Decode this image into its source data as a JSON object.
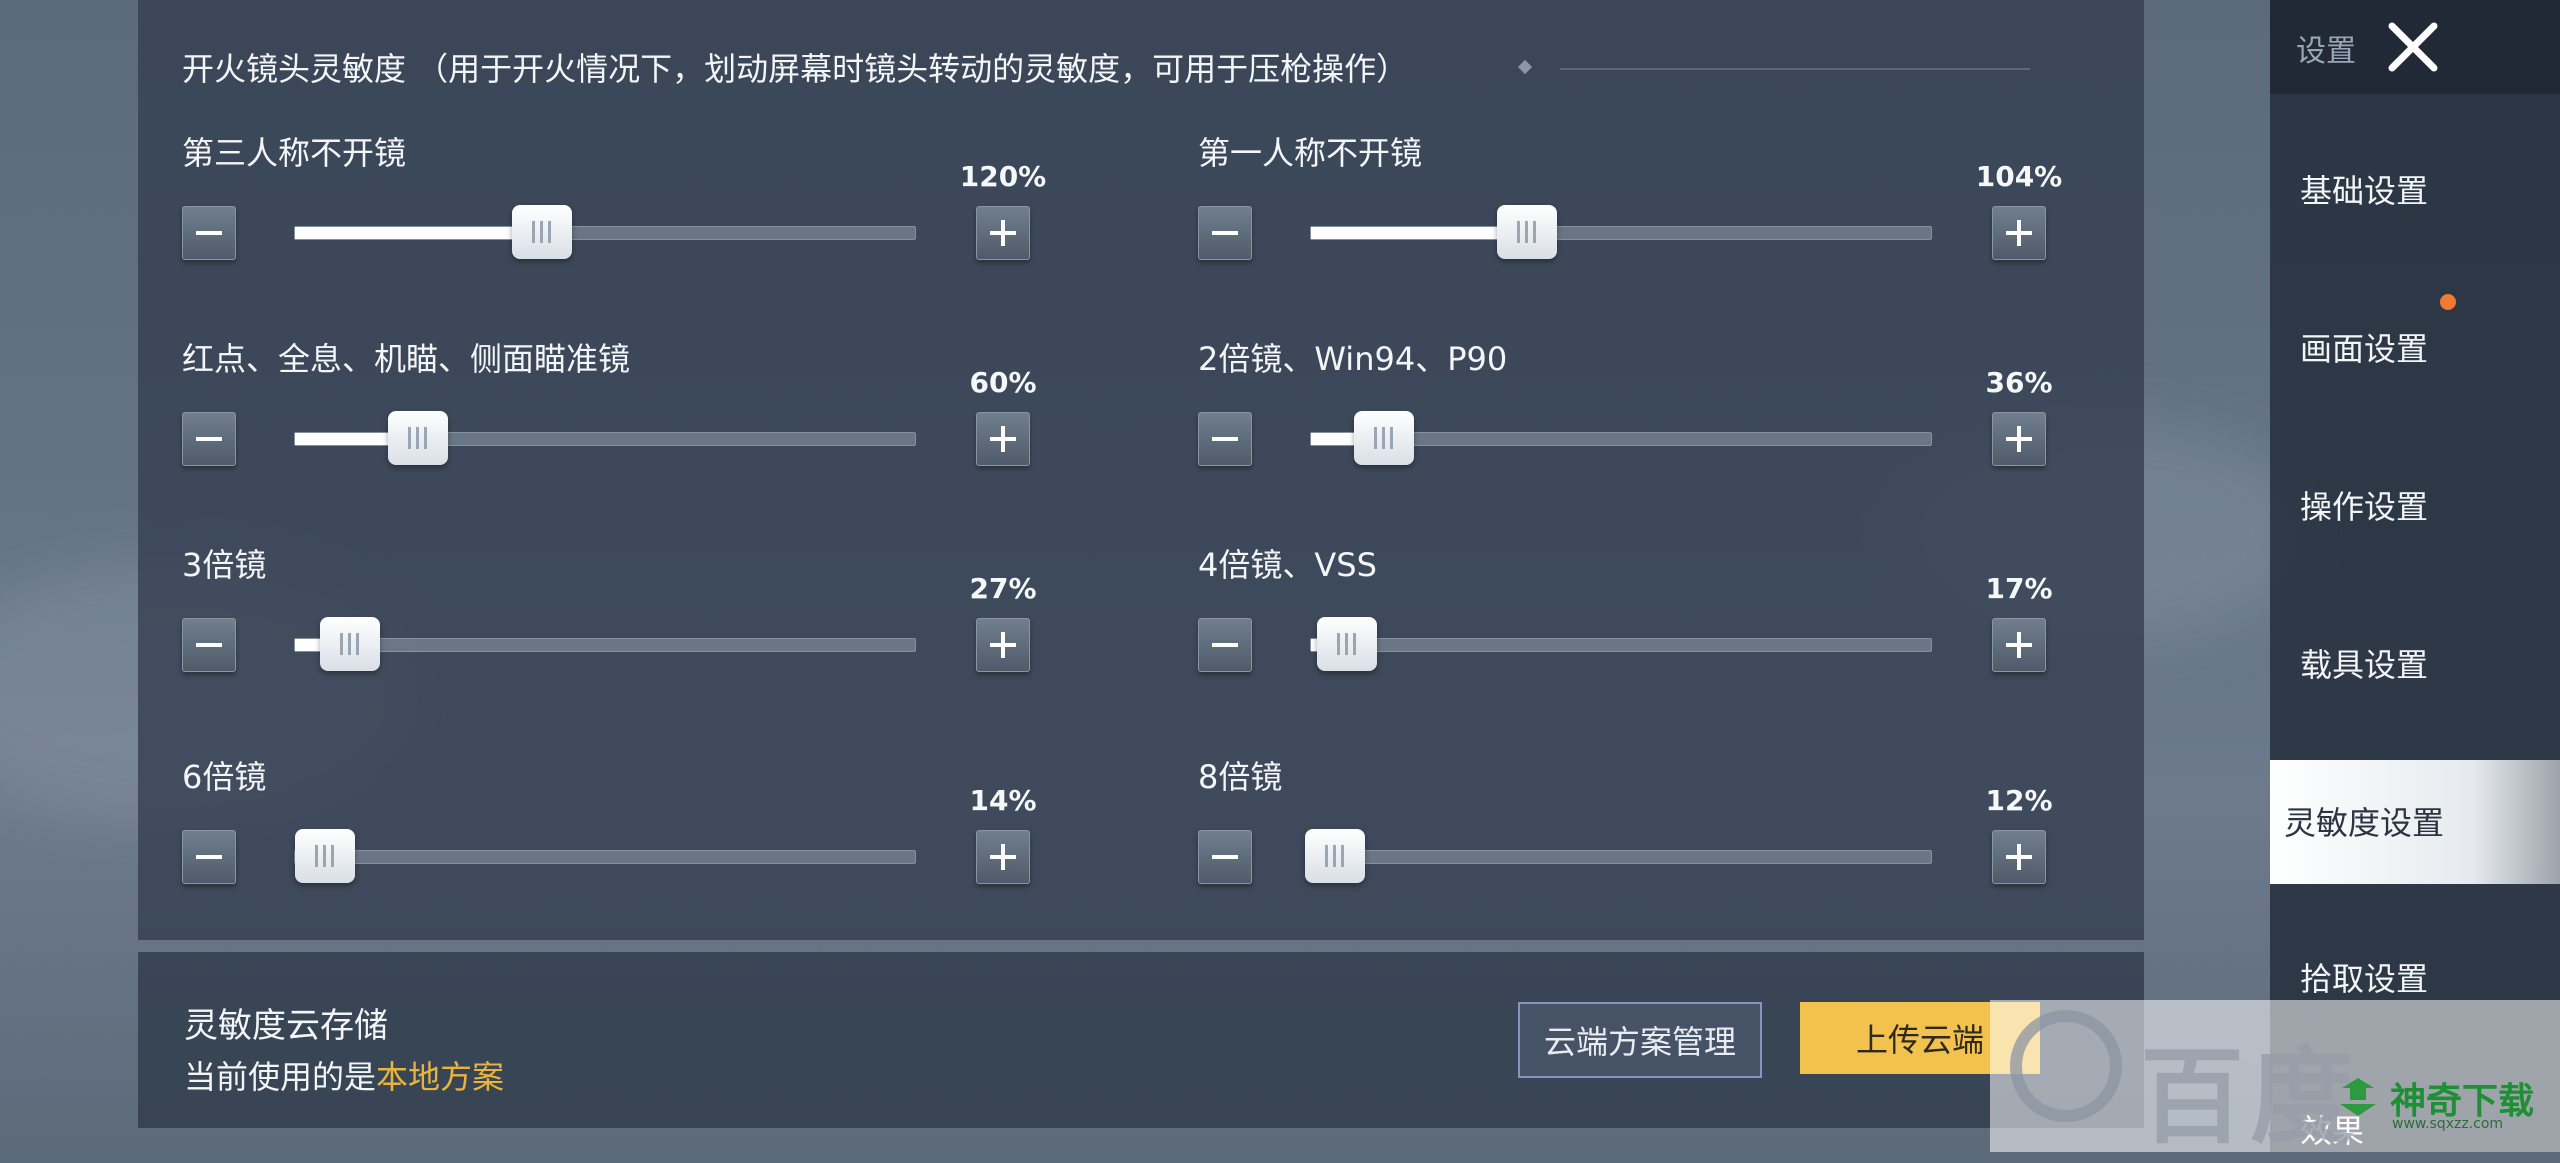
{
  "section": {
    "title": "开火镜头灵敏度 （用于开火情况下，划动屏幕时镜头转动的灵敏度，可用于压枪操作）"
  },
  "sliders": [
    {
      "label": "第三人称不开镜",
      "percent": "120%",
      "fraction": 0.4
    },
    {
      "label": "第一人称不开镜",
      "percent": "104%",
      "fraction": 0.35
    },
    {
      "label": "红点、全息、机瞄、侧面瞄准镜",
      "percent": "60%",
      "fraction": 0.2
    },
    {
      "label": "2倍镜、Win94、P90",
      "percent": "36%",
      "fraction": 0.12
    },
    {
      "label": "3倍镜",
      "percent": "27%",
      "fraction": 0.09
    },
    {
      "label": "4倍镜、VSS",
      "percent": "17%",
      "fraction": 0.06
    },
    {
      "label": "6倍镜",
      "percent": "14%",
      "fraction": 0.05
    },
    {
      "label": "8倍镜",
      "percent": "12%",
      "fraction": 0.04
    }
  ],
  "cloud": {
    "title": "灵敏度云存储",
    "current_prefix": "当前使用的是",
    "current_value": "本地方案",
    "manage_label": "云端方案管理",
    "upload_label": "上传云端"
  },
  "sidebar": {
    "header": "设置",
    "items": [
      {
        "label": "基础设置"
      },
      {
        "label": "画面设置"
      },
      {
        "label": "操作设置"
      },
      {
        "label": "载具设置"
      },
      {
        "label": "灵敏度设置"
      },
      {
        "label": "拾取设置"
      },
      {
        "label": "效果"
      }
    ],
    "active_index": 4
  },
  "watermark": {
    "brand": "百度",
    "site": "神奇下载",
    "url": "www.sqxzz.com"
  },
  "colors": {
    "highlight": "#e8b43c",
    "upload_button": "#f2c14e",
    "notify_dot": "#f07a2e"
  }
}
